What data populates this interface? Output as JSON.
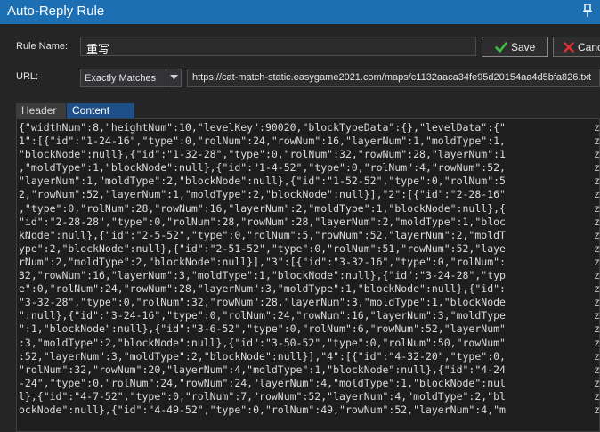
{
  "window": {
    "title": "Auto-Reply Rule"
  },
  "form": {
    "rule_name_label": "Rule Name:",
    "rule_name_value": "重写",
    "url_label": "URL:",
    "match_mode": "Exactly Matches",
    "url_value": "https://cat-match-static.easygame2021.com/maps/c1132aaca34fe95d20154aa4d5bfa826.txt"
  },
  "buttons": {
    "save": "Save",
    "cancel": "Canc"
  },
  "tabs": [
    {
      "label": "Header",
      "active": false
    },
    {
      "label": "Content",
      "active": true
    }
  ],
  "colors": {
    "titlebar": "#1c6fb3",
    "active_tab": "#1e4f86",
    "save_check": "#3fbf3f",
    "cancel_x": "#e03030"
  },
  "content": {
    "lines": [
      "{\"widthNum\":8,\"heightNum\":10,\"levelKey\":90020,\"blockTypeData\":{},\"levelData\":{\"",
      "1\":[{\"id\":\"1-24-16\",\"type\":0,\"rolNum\":24,\"rowNum\":16,\"layerNum\":1,\"moldType\":1,",
      "\"blockNode\":null},{\"id\":\"1-32-28\",\"type\":0,\"rolNum\":32,\"rowNum\":28,\"layerNum\":1",
      ",\"moldType\":1,\"blockNode\":null},{\"id\":\"1-4-52\",\"type\":0,\"rolNum\":4,\"rowNum\":52,",
      "\"layerNum\":1,\"moldType\":2,\"blockNode\":null},{\"id\":\"1-52-52\",\"type\":0,\"rolNum\":5",
      "2,\"rowNum\":52,\"layerNum\":1,\"moldType\":2,\"blockNode\":null}],\"2\":[{\"id\":\"2-28-16\"",
      ",\"type\":0,\"rolNum\":28,\"rowNum\":16,\"layerNum\":2,\"moldType\":1,\"blockNode\":null},{",
      "\"id\":\"2-28-28\",\"type\":0,\"rolNum\":28,\"rowNum\":28,\"layerNum\":2,\"moldType\":1,\"bloc",
      "kNode\":null},{\"id\":\"2-5-52\",\"type\":0,\"rolNum\":5,\"rowNum\":52,\"layerNum\":2,\"moldT",
      "ype\":2,\"blockNode\":null},{\"id\":\"2-51-52\",\"type\":0,\"rolNum\":51,\"rowNum\":52,\"laye",
      "rNum\":2,\"moldType\":2,\"blockNode\":null}],\"3\":[{\"id\":\"3-32-16\",\"type\":0,\"rolNum\":",
      "32,\"rowNum\":16,\"layerNum\":3,\"moldType\":1,\"blockNode\":null},{\"id\":\"3-24-28\",\"typ",
      "e\":0,\"rolNum\":24,\"rowNum\":28,\"layerNum\":3,\"moldType\":1,\"blockNode\":null},{\"id\":",
      "\"3-32-28\",\"type\":0,\"rolNum\":32,\"rowNum\":28,\"layerNum\":3,\"moldType\":1,\"blockNode",
      "\":null},{\"id\":\"3-24-16\",\"type\":0,\"rolNum\":24,\"rowNum\":16,\"layerNum\":3,\"moldType",
      "\":1,\"blockNode\":null},{\"id\":\"3-6-52\",\"type\":0,\"rolNum\":6,\"rowNum\":52,\"layerNum\"",
      ":3,\"moldType\":2,\"blockNode\":null},{\"id\":\"3-50-52\",\"type\":0,\"rolNum\":50,\"rowNum\"",
      ":52,\"layerNum\":3,\"moldType\":2,\"blockNode\":null}],\"4\":[{\"id\":\"4-32-20\",\"type\":0,",
      "\"rolNum\":32,\"rowNum\":20,\"layerNum\":4,\"moldType\":1,\"blockNode\":null},{\"id\":\"4-24",
      "-24\",\"type\":0,\"rolNum\":24,\"rowNum\":24,\"layerNum\":4,\"moldType\":1,\"blockNode\":nul",
      "l},{\"id\":\"4-7-52\",\"type\":0,\"rolNum\":7,\"rowNum\":52,\"layerNum\":4,\"moldType\":2,\"bl",
      "ockNode\":null},{\"id\":\"4-49-52\",\"type\":0,\"rolNum\":49,\"rowNum\":52,\"layerNum\":4,\"m"
    ],
    "right_edge": [
      "z",
      "z",
      "z",
      "z",
      "z",
      "z",
      "z",
      "z",
      "z",
      "z",
      "z",
      "z",
      "z",
      "z",
      "z",
      "z",
      "z",
      "z",
      "z",
      "z",
      "z",
      "z"
    ]
  }
}
